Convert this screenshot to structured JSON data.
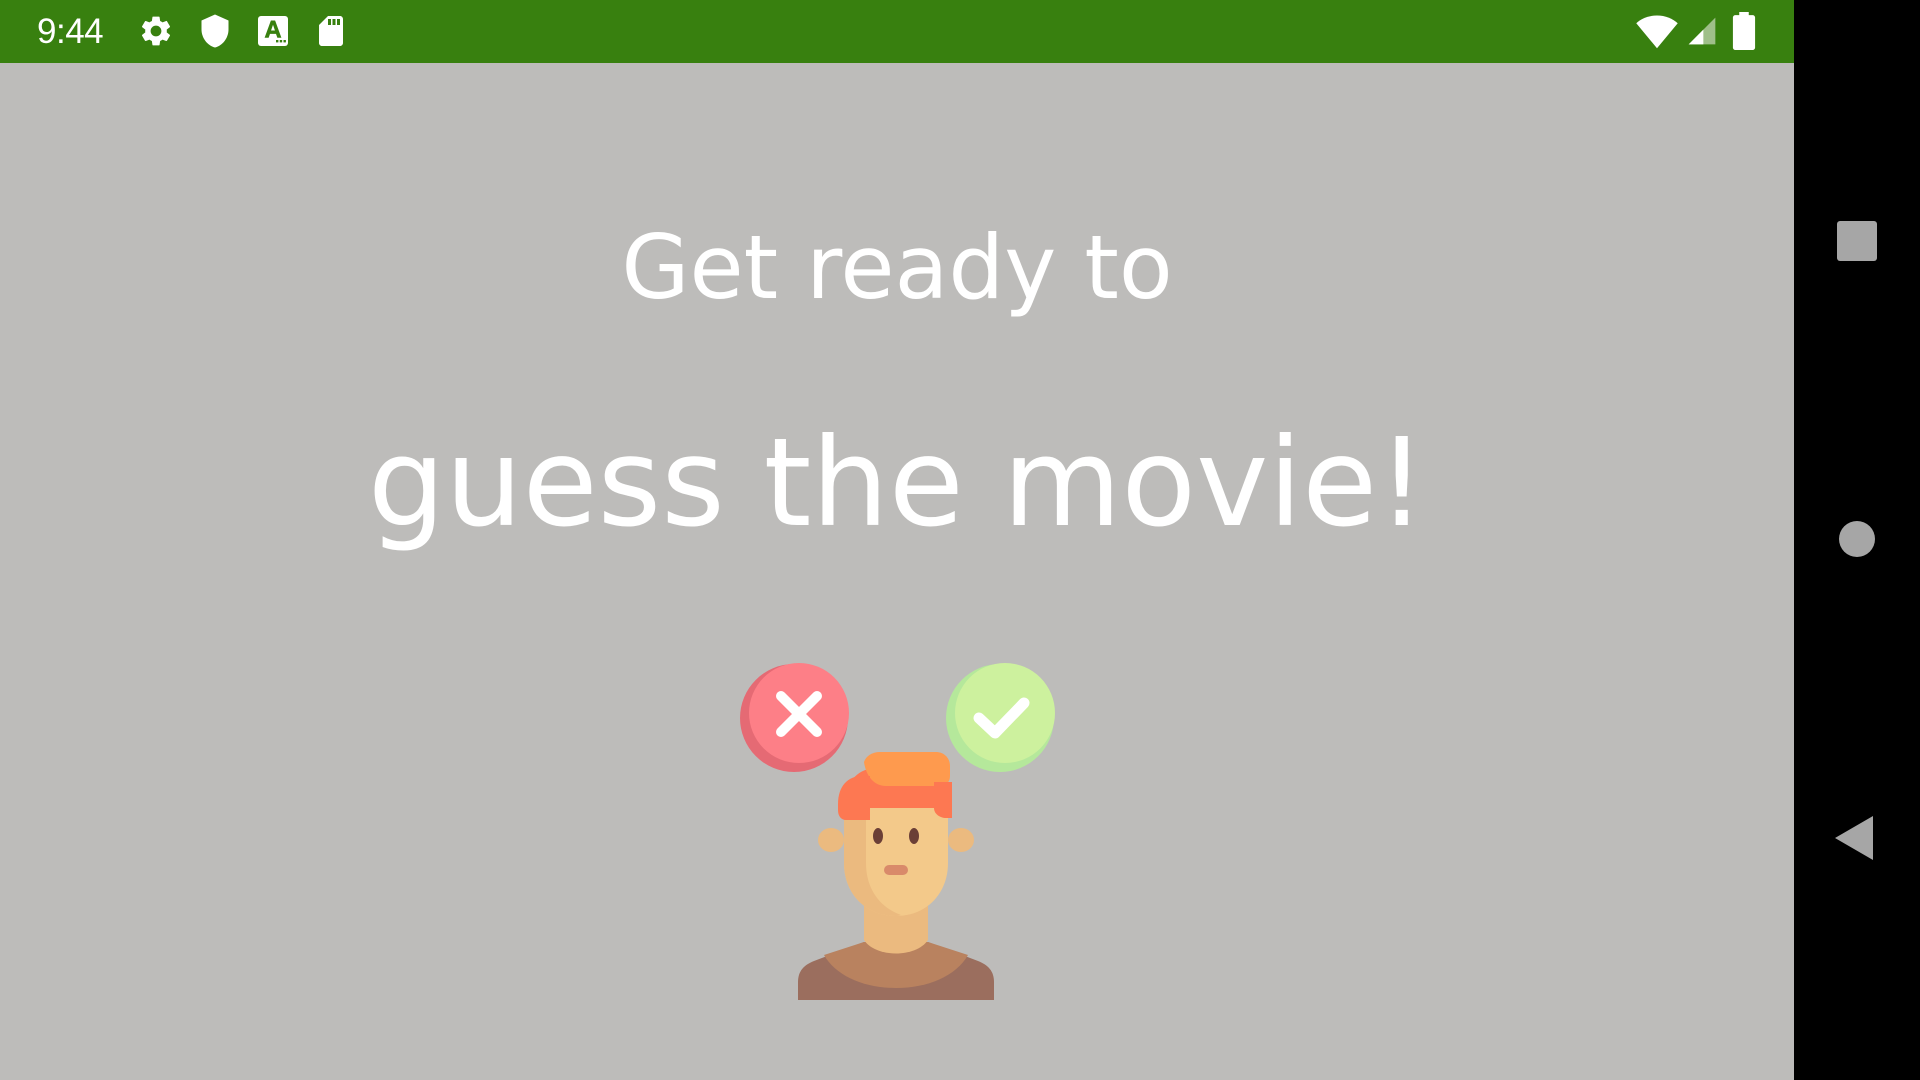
{
  "status_bar": {
    "time": "9:44",
    "background_color": "#38800f",
    "left_icons": [
      "settings-icon",
      "shield-icon",
      "text-a-icon",
      "sd-card-icon"
    ],
    "right_icons": [
      "wifi-icon",
      "cell-signal-icon",
      "battery-icon"
    ]
  },
  "main": {
    "background_color": "#bdbcba",
    "headline_line1": "Get ready to",
    "headline_line2": "guess the movie!",
    "illustration": {
      "wrong_icon": "x-mark-icon",
      "correct_icon": "check-mark-icon",
      "person": "person-avatar"
    }
  },
  "nav_bar": {
    "buttons": [
      "recents-button",
      "home-button",
      "back-button"
    ]
  }
}
